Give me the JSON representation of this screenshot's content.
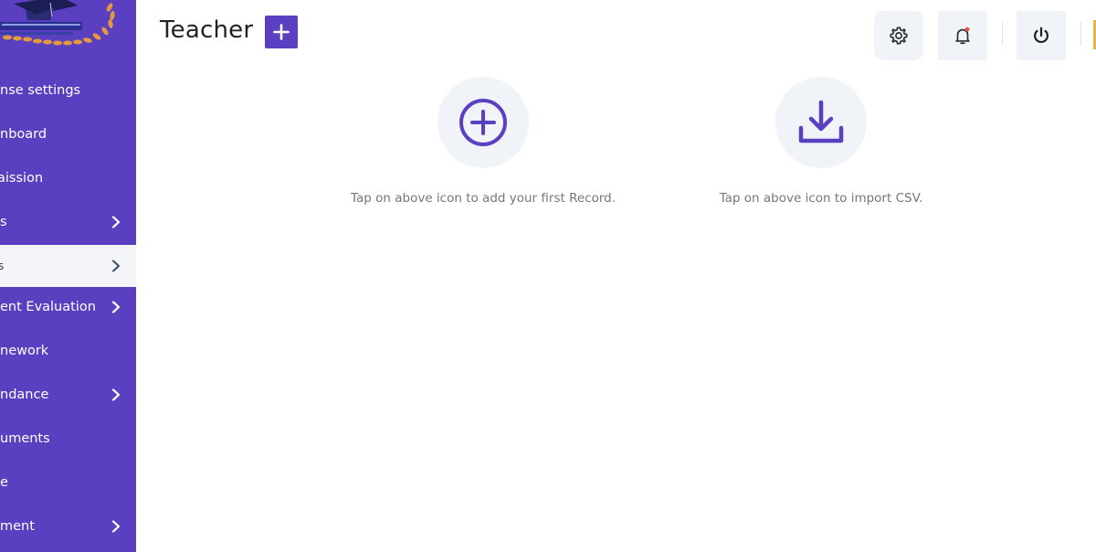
{
  "header": {
    "title": "Teacher"
  },
  "sidebar": {
    "items": [
      {
        "label": "nse settings",
        "has_chevron": false
      },
      {
        "label": "nboard",
        "has_chevron": false
      },
      {
        "label": "aission",
        "has_chevron": false
      },
      {
        "label": "s",
        "has_chevron": true
      },
      {
        "label": "s",
        "has_chevron": true,
        "active": true
      },
      {
        "label": "ent Evaluation",
        "has_chevron": true
      },
      {
        "label": "nework",
        "has_chevron": false
      },
      {
        "label": "ndance",
        "has_chevron": true
      },
      {
        "label": "uments",
        "has_chevron": false
      },
      {
        "label": "e",
        "has_chevron": false
      },
      {
        "label": "ment",
        "has_chevron": true
      }
    ]
  },
  "main": {
    "add_hint": "Tap on above icon to add your first Record.",
    "import_hint": "Tap on above icon to import CSV."
  },
  "colors": {
    "sidebar_bg": "#5a3fc0",
    "accent": "#5a3fc0",
    "active_item_bg": "#f3f5f9",
    "icon_button_bg": "#f0f3f8",
    "notification_dot": "#e5533d",
    "edge_accent": "#e6b64a"
  },
  "icons": {
    "settings": "gear-icon",
    "notifications": "bell-icon",
    "logout": "power-icon",
    "add_record": "plus-circle-icon",
    "import_csv": "download-icon"
  }
}
